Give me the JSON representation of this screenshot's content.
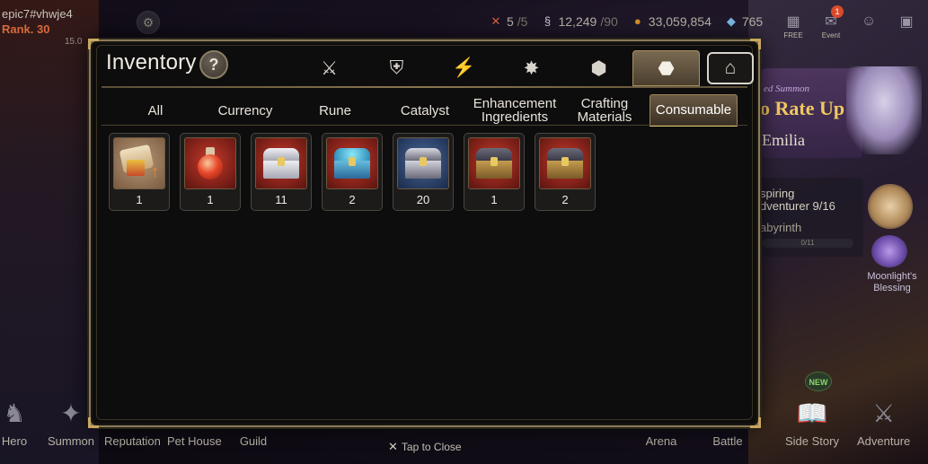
{
  "player": {
    "id": "epic7#vhwje4",
    "rank": "Rank. 30",
    "mini_value": "15.0"
  },
  "resources": {
    "stamina": {
      "icon": "stamina-icon",
      "value": "5",
      "max": "/5"
    },
    "skystone": {
      "icon": "energy-icon",
      "value": "12,249",
      "max": "/90"
    },
    "gold": {
      "icon": "gold-coin-icon",
      "value": "33,059,854"
    },
    "gems": {
      "icon": "gem-icon",
      "value": "765"
    }
  },
  "top_right": {
    "free": {
      "label": "FREE",
      "icon": "shop-icon"
    },
    "event": {
      "label": "Event",
      "icon": "mail-icon",
      "badge": "1"
    },
    "chat": {
      "icon": "chat-icon"
    },
    "menu": {
      "icon": "menu-grid-icon"
    }
  },
  "inventory": {
    "title": "Inventory",
    "help": "?",
    "category_icons": [
      {
        "name": "equipment-icon",
        "glyph": "⚔"
      },
      {
        "name": "artifact-icon",
        "glyph": "⛨"
      },
      {
        "name": "lightning-icon",
        "glyph": "⚡"
      },
      {
        "name": "material-icon",
        "glyph": "✸"
      },
      {
        "name": "cube-icon",
        "glyph": "⬢"
      },
      {
        "name": "bag-icon",
        "glyph": "⬣",
        "selected": true
      },
      {
        "name": "storage-icon",
        "glyph": "⌂"
      }
    ],
    "tabs": [
      {
        "label": "All",
        "width": 110
      },
      {
        "label": "Currency",
        "width": 90
      },
      {
        "label": "Rune",
        "width": 110
      },
      {
        "label": "Catalyst",
        "width": 90
      },
      {
        "label": "Enhancement\nIngredients",
        "width": 110
      },
      {
        "label": "Crafting\nMaterials",
        "width": 90
      },
      {
        "label": "Consumable",
        "width": 98,
        "selected": true
      }
    ],
    "items": [
      {
        "name": "upgrade-scroll-item",
        "count": "1"
      },
      {
        "name": "red-potion-item",
        "count": "1"
      },
      {
        "name": "silver-chest-item",
        "count": "11"
      },
      {
        "name": "blue-chest-item",
        "count": "2"
      },
      {
        "name": "dark-chest-item",
        "count": "20"
      },
      {
        "name": "gold-chest-item",
        "count": "1"
      },
      {
        "name": "gold-chest-item-2",
        "count": "2"
      }
    ]
  },
  "side_panel": {
    "summon_tag": "ed Summon",
    "summon_title": "o Rate Up",
    "summon_name": "Emilia",
    "quest_line1": "spiring",
    "quest_line2": "dventurer 9/16",
    "quest_sub": "abyrinth",
    "quest_progress": "0/11",
    "moonlight_label": "Moonlight's Blessing"
  },
  "bottom_nav": [
    {
      "label": "Hero",
      "icon": "hero-icon"
    },
    {
      "label": "Summon",
      "icon": "summon-icon"
    },
    {
      "label": "Reputation",
      "icon": "reputation-icon"
    },
    {
      "label": "Pet House",
      "icon": "pet-house-icon"
    },
    {
      "label": "Guild",
      "icon": "guild-icon"
    },
    {
      "label": "Arena",
      "icon": "arena-icon"
    },
    {
      "label": "Battle",
      "icon": "battle-icon"
    },
    {
      "label": "Side Story",
      "icon": "side-story-icon",
      "badge": "NEW"
    },
    {
      "label": "Adventure",
      "icon": "adventure-icon"
    }
  ],
  "close_hint": "Tap to Close"
}
